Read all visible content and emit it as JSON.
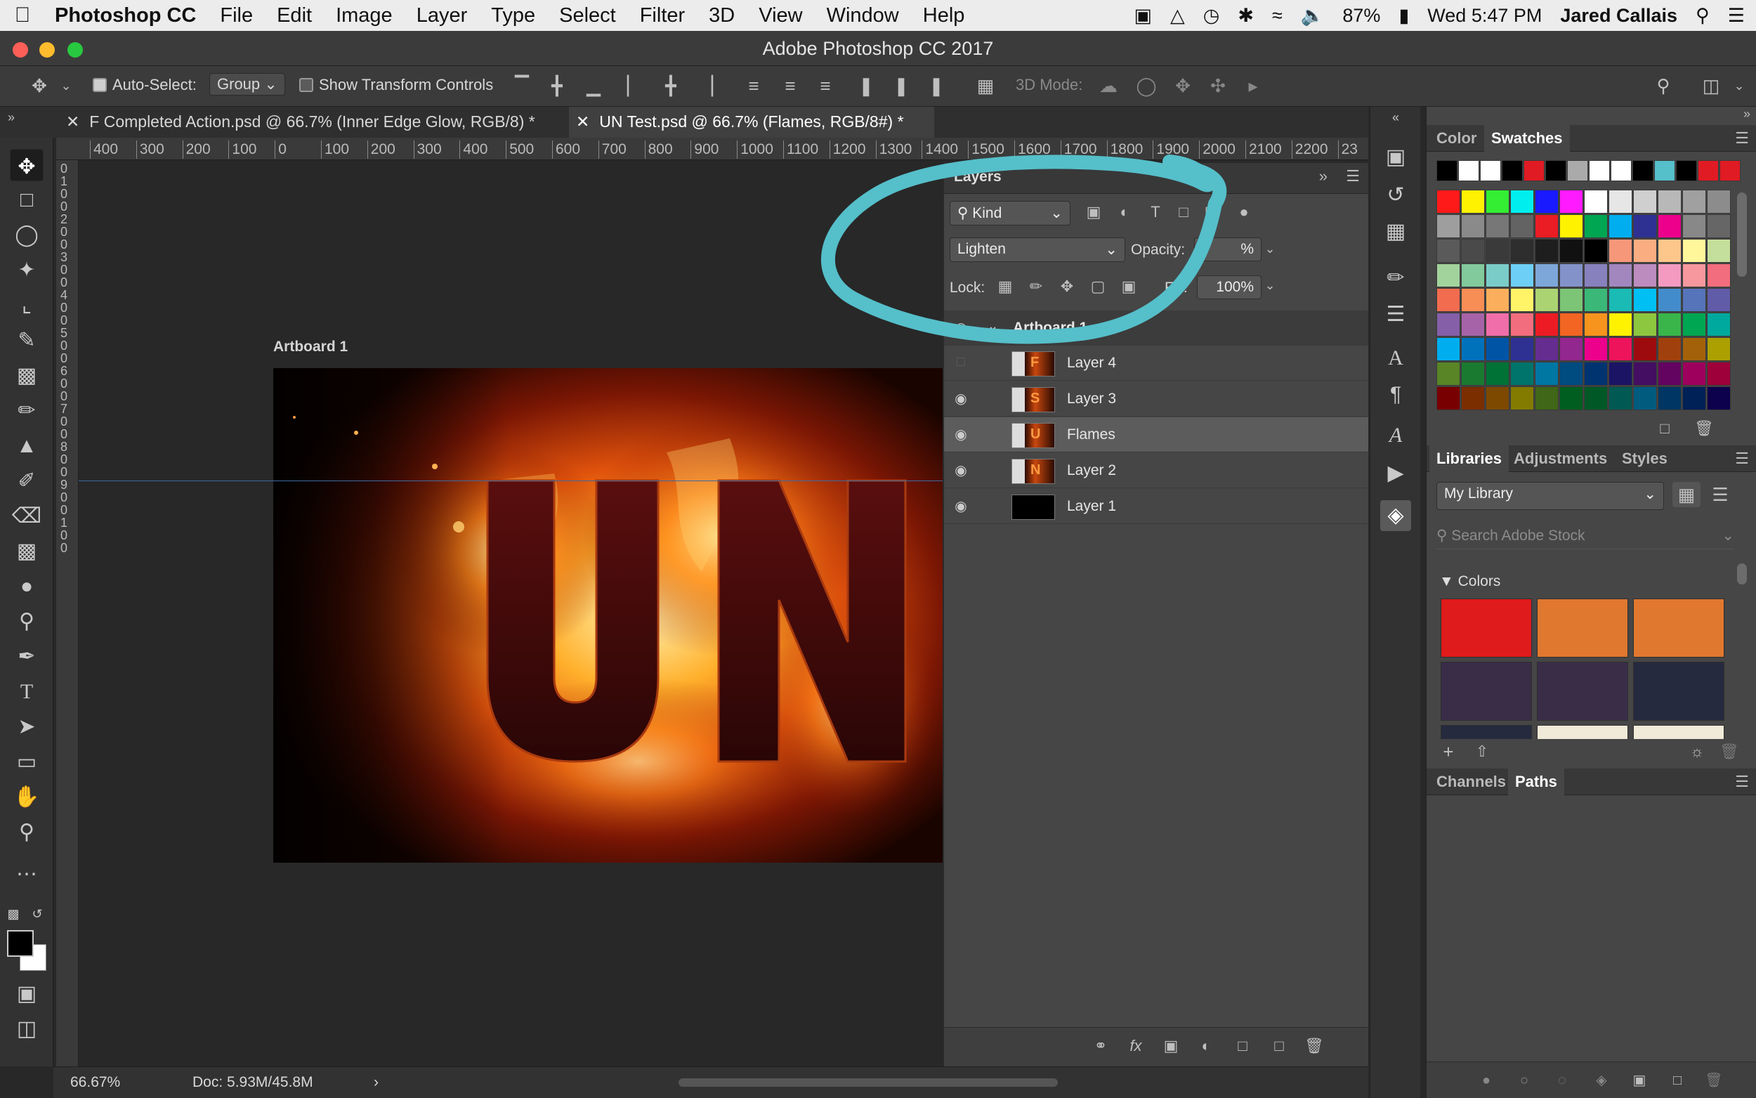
{
  "menubar": {
    "app_name": "Photoshop CC",
    "items": [
      "File",
      "Edit",
      "Image",
      "Layer",
      "Type",
      "Select",
      "Filter",
      "3D",
      "View",
      "Window",
      "Help"
    ],
    "battery": "87%",
    "clock": "Wed 5:47 PM",
    "user": "Jared Callais"
  },
  "window": {
    "title": "Adobe Photoshop CC 2017"
  },
  "options": {
    "auto_select_label": "Auto-Select:",
    "auto_select_value": "Group",
    "show_transform_label": "Show Transform Controls",
    "mode3d_label": "3D Mode:"
  },
  "tabs": [
    {
      "label": "F Completed Action.psd @ 66.7% (Inner Edge Glow, RGB/8) *"
    },
    {
      "label": "UN Test.psd @ 66.7% (Flames, RGB/8#) *"
    }
  ],
  "ruler_h": [
    "400",
    "300",
    "200",
    "100",
    "0",
    "100",
    "200",
    "300",
    "400",
    "500",
    "600",
    "700",
    "800",
    "900",
    "1000",
    "1100",
    "1200",
    "1300",
    "1400",
    "1500",
    "1600",
    "1700",
    "1800",
    "1900",
    "2000",
    "2100",
    "2200",
    "23"
  ],
  "ruler_v": [
    "0",
    "1",
    "0",
    "0",
    "2",
    "0",
    "0",
    "3",
    "0",
    "0",
    "4",
    "0",
    "0",
    "5",
    "0",
    "0",
    "6",
    "0",
    "0",
    "7",
    "0",
    "0",
    "8",
    "0",
    "0",
    "9",
    "0",
    "0",
    "1",
    "0",
    "0"
  ],
  "canvas": {
    "artboard_label": "Artboard 1",
    "text": "UN"
  },
  "status": {
    "zoom": "66.67%",
    "doc": "Doc: 5.93M/45.8M"
  },
  "layers_panel": {
    "title": "Layers",
    "filter_kind": "Kind",
    "blend_mode": "Lighten",
    "opacity_label": "Opacity:",
    "opacity_value": "%",
    "lock_label": "Lock:",
    "fill_label": "Fill:",
    "fill_value": "100%",
    "group_name": "Artboard 1",
    "layers": [
      {
        "name": "Layer 4",
        "visible": false,
        "thumb_letter": "F"
      },
      {
        "name": "Layer 3",
        "visible": true,
        "thumb_letter": "S"
      },
      {
        "name": "Flames",
        "visible": true,
        "thumb_letter": "U",
        "selected": true
      },
      {
        "name": "Layer 2",
        "visible": true,
        "thumb_letter": "N"
      },
      {
        "name": "Layer 1",
        "visible": true,
        "thumb_letter": ""
      }
    ]
  },
  "color_panel": {
    "tabs": [
      "Color",
      "Swatches"
    ],
    "active_tab": "Swatches"
  },
  "libraries_panel": {
    "tabs": [
      "Libraries",
      "Adjustments",
      "Styles"
    ],
    "library": "My Library",
    "search_placeholder": "Search Adobe Stock",
    "colors_label": "Colors",
    "colors": [
      "#e01b1b",
      "#e0782f",
      "#e0782f",
      "#3a2d48",
      "#3a2d48",
      "#262a3e"
    ]
  },
  "channels_panel": {
    "tabs": [
      "Channels",
      "Paths"
    ],
    "active_tab": "Paths"
  },
  "annotation_color": "#55bfca"
}
